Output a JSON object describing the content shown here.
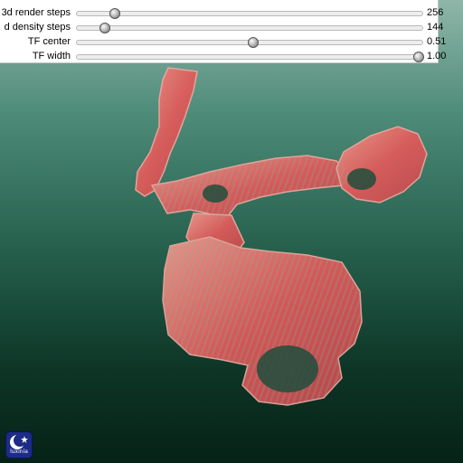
{
  "controls": {
    "sliders": [
      {
        "label": "3d render steps",
        "value": "256",
        "fraction": 0.11
      },
      {
        "label": "d density steps",
        "value": "144",
        "fraction": 0.08
      },
      {
        "label": "TF center",
        "value": "0.51",
        "fraction": 0.51
      },
      {
        "label": "TF width",
        "value": "1.00",
        "fraction": 1.0
      }
    ]
  },
  "viewport": {
    "colors": {
      "volume": "#e25a5a",
      "volume_highlight": "#f49a8e",
      "background_top": "#8fb6a9",
      "background_bottom": "#062217"
    }
  },
  "logo": {
    "text": "luxinia",
    "icon": "moon-star-icon"
  }
}
